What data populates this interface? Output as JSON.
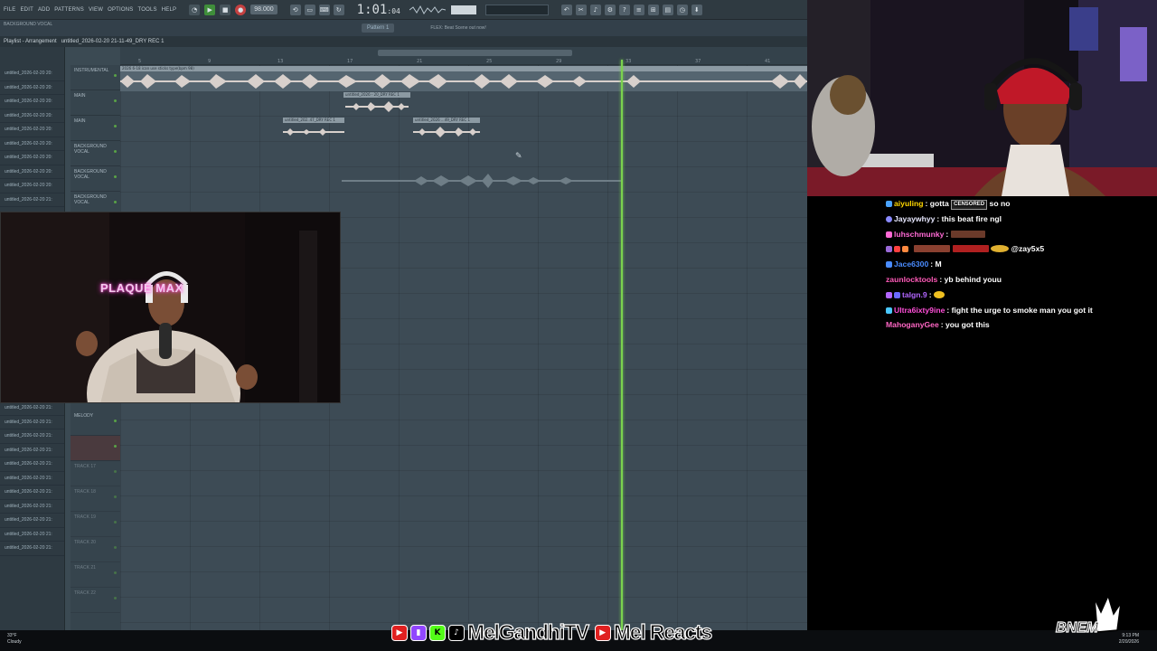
{
  "daw": {
    "menu": [
      "File",
      "Edit",
      "Add",
      "Patterns",
      "View",
      "Options",
      "Tools",
      "Help"
    ],
    "bpm": "98.000",
    "time": "1:01",
    "time_sub": "04",
    "pattern": "Pattern 1",
    "news": "FLEX: Beat Scene out now!",
    "playlist_title": "Playlist - Arrangement",
    "project_title": "untitled_2026-02-20 21-11-49_DRY REC 1",
    "hint_left": "BACKGROUND VOCAL",
    "timeline_marks": [
      "5",
      "9",
      "13",
      "17",
      "21",
      "25",
      "29",
      "33",
      "37",
      "41"
    ],
    "browser_items": [
      "untitled_2026-02-20 20:",
      "untitled_2026-02-20 20:",
      "untitled_2026-02-20 20:",
      "untitled_2026-02-20 20:",
      "untitled_2026-02-20 20:",
      "untitled_2026-02-20 20:",
      "untitled_2026-02-20 20:",
      "untitled_2026-02-20 20:",
      "untitled_2026-02-20 20:",
      "untitled_2026-02-20 21:",
      "untitled_2026-02-20 21:",
      "untitled_2026-02-20 21:",
      "untitled_2026-02-20 21:",
      "untitled_2026-02-20 21:",
      "untitled_2026-02-20 21:",
      "untitled_2026-02-20 21:",
      "untitled_2026-02-20 21:",
      "untitled_2026-02-20 21:",
      "untitled_2026-02-20 21:",
      "untitled_2026-02-20 21:",
      "untitled_2026-02-20 21:"
    ],
    "tracks": [
      "Instrumental",
      "Main",
      "Main",
      "Background Vocal",
      "Background Vocal",
      "Background Vocal"
    ],
    "tracks_lower": [
      "Melody",
      "",
      "Track 17",
      "Track 18",
      "Track 19",
      "Track 20",
      "Track 21",
      "Track 22"
    ],
    "clips": {
      "instrumental": "2026 6-18 ican use sticks type(bpm 98)",
      "main1": "untitled_2026 - 20_DRY REC 1",
      "main2a": "untitled_202..47_DRY REC 1",
      "main2b": "untitled_2026 ...49_DRY REC 1"
    }
  },
  "cam1": {
    "sign": "PLAQUE MAX"
  },
  "chat": [
    {
      "name": "aiyuling",
      "name_color": "#ffd700",
      "text": "gotta",
      "censored": "CENSORED",
      "text2": "so no"
    },
    {
      "name": "Jayaywhyy",
      "name_color": "#e8e8ff",
      "text": "this beat fire ngl"
    },
    {
      "name": "luhschmunky",
      "name_color": "#ff6ad5",
      "text": ""
    },
    {
      "name": "",
      "name_color": "#ff4040",
      "text": "@zay5x5"
    },
    {
      "name": "Jace6300",
      "name_color": "#4a8cff",
      "text": "M"
    },
    {
      "name": "zaunlocktools",
      "name_color": "#ff5ab8",
      "text": "yb behind youu"
    },
    {
      "name": "talgn.9",
      "name_color": "#b266ff",
      "text": ""
    },
    {
      "name": "Ultra6ixty9ine",
      "name_color": "#ff4fd8",
      "text": "fight the urge to smoke man you got it"
    },
    {
      "name": "MahoganyGee",
      "name_color": "#ff66c4",
      "text": "you got this"
    }
  ],
  "footer": {
    "handle1": "MelGandhiTV",
    "handle2": "Mel Reacts",
    "logo": "BNEM",
    "weather_temp": "33°F",
    "weather_desc": "Cloudy",
    "clock_time": "9:13 PM",
    "clock_date": "2/20/2026"
  }
}
